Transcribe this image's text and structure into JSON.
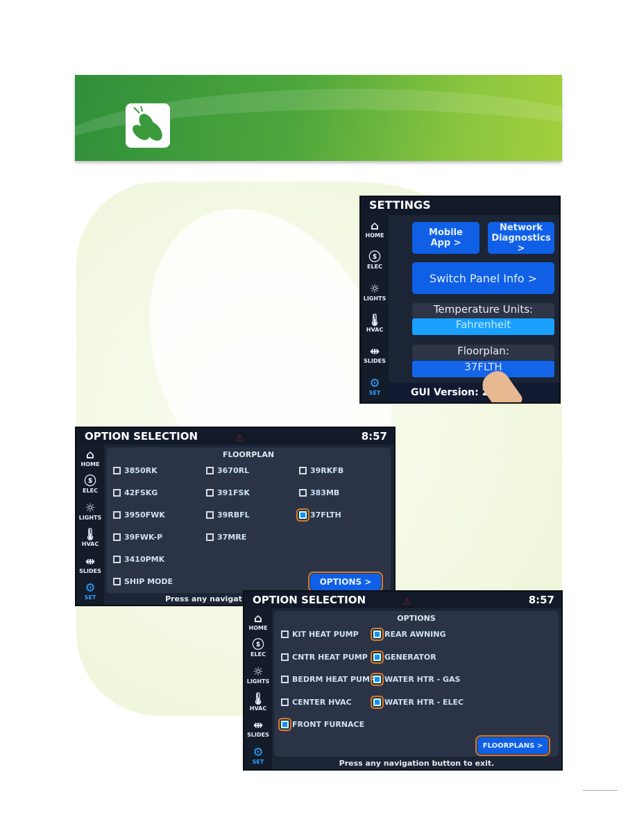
{
  "colors": {
    "accent": "#0f60e6",
    "checked": "#1e8cf0",
    "highlight": "#d77a2e",
    "banner": "#4da63c"
  },
  "nav": [
    {
      "label": "HOME",
      "icon": "home-icon",
      "glyph": "⌂"
    },
    {
      "label": "ELEC",
      "icon": "electric-icon",
      "glyph": "ⓢ"
    },
    {
      "label": "LIGHTS",
      "icon": "lightbulb-icon",
      "glyph": "☼"
    },
    {
      "label": "HVAC",
      "icon": "thermometer-icon",
      "glyph": "🌡"
    },
    {
      "label": "SLIDES",
      "icon": "slides-icon",
      "glyph": "⇹"
    },
    {
      "label": "SET",
      "icon": "gear-icon",
      "glyph": "⚙"
    }
  ],
  "settings": {
    "title": "SETTINGS",
    "mobile_app": "Mobile App >",
    "network": "Network Diagnostics >",
    "switch_panel": "Switch Panel Info >",
    "temp_label": "Temperature Units:",
    "temp_value": "Fahrenheit",
    "floorplan_label": "Floorplan:",
    "floorplan_value": "37FLTH",
    "gui_version": "GUI Version: 2.1"
  },
  "floorplan_screen": {
    "title": "OPTION SELECTION",
    "time": "8:57",
    "section": "FLOORPLAN",
    "items": [
      {
        "label": "3850RK",
        "checked": false
      },
      {
        "label": "3670RL",
        "checked": false
      },
      {
        "label": "39RKFB",
        "checked": false
      },
      {
        "label": "42FSKG",
        "checked": false
      },
      {
        "label": "391FSK",
        "checked": false
      },
      {
        "label": "383MB",
        "checked": false
      },
      {
        "label": "3950FWK",
        "checked": false
      },
      {
        "label": "39RBFL",
        "checked": false
      },
      {
        "label": "37FLTH",
        "checked": true
      },
      {
        "label": "39FWK-P",
        "checked": false
      },
      {
        "label": "37MRE",
        "checked": false
      },
      {
        "label": "3410PMK",
        "checked": false
      },
      {
        "label": "SHIP MODE",
        "checked": false
      }
    ],
    "button": "OPTIONS >",
    "footer": "Press any navigat"
  },
  "options_screen": {
    "title": "OPTION SELECTION",
    "time": "8:57",
    "section": "OPTIONS",
    "left": [
      {
        "label": "KIT HEAT PUMP",
        "checked": false
      },
      {
        "label": "CNTR HEAT PUMP",
        "checked": false
      },
      {
        "label": "BEDRM HEAT PUMP",
        "checked": false
      },
      {
        "label": "CENTER HVAC",
        "checked": false
      },
      {
        "label": "FRONT FURNACE",
        "checked": true
      }
    ],
    "right": [
      {
        "label": "REAR AWNING",
        "checked": true
      },
      {
        "label": "GENERATOR",
        "checked": true
      },
      {
        "label": "WATER HTR - GAS",
        "checked": true
      },
      {
        "label": "WATER HTR - ELEC",
        "checked": true
      }
    ],
    "button": "FLOORPLANS >",
    "footer": "Press any navigation button to exit."
  }
}
